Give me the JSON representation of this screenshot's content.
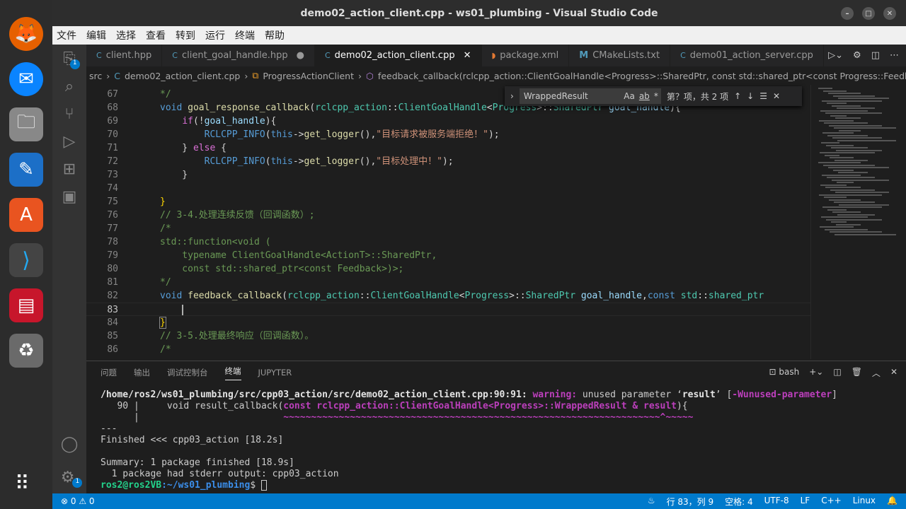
{
  "window": {
    "title": "demo02_action_client.cpp - ws01_plumbing - Visual Studio Code"
  },
  "menu": [
    "文件",
    "编辑",
    "选择",
    "查看",
    "转到",
    "运行",
    "终端",
    "帮助"
  ],
  "tabs": [
    {
      "label": "client.hpp"
    },
    {
      "label": "client_goal_handle.hpp"
    },
    {
      "label": "demo02_action_client.cpp"
    },
    {
      "label": "package.xml"
    },
    {
      "label": "CMakeLists.txt"
    },
    {
      "label": "demo01_action_server.cpp"
    }
  ],
  "breadcrumb": [
    "src",
    "demo02_action_client.cpp",
    "ProgressActionClient",
    "feedback_callback(rclcpp_action::ClientGoalHandle<Progress>::SharedPtr, const std::shared_ptr<const Progress::Feedback>)"
  ],
  "find": {
    "value": "WrappedResult",
    "options": [
      "Aa",
      "ab",
      "*"
    ],
    "result": "第？项，共 2 项"
  },
  "code": {
    "numbers": [
      "67",
      "68",
      "69",
      "70",
      "71",
      "72",
      "73",
      "74",
      "75",
      "76",
      "77",
      "78",
      "79",
      "80",
      "81",
      "82",
      "83",
      "84",
      "85",
      "86"
    ]
  },
  "panel": {
    "tabs": [
      "问题",
      "输出",
      "调试控制台",
      "终端",
      "JUPYTER"
    ],
    "shell": "bash"
  },
  "terminal": {
    "path": "/home/ros2/ws01_plumbing/src/cpp03_action/src/demo02_action_client.cpp:90:91:",
    "warning": "warning:",
    "msg1": " unused parameter ‘",
    "param": "result",
    "msg2": "’ [",
    "flag": "-Wunused-parameter",
    "msg3": "]",
    "l2a": "   90 |     void result_callback(",
    "l2b": "const rclcpp_action::ClientGoalHandle<Progress>::WrappedResult & result",
    "l2c": "){",
    "l3a": "      |                          ",
    "l3b": "~~~~~~~~~~~~~~~~~~~~~~~~~~~~~~~~~~~~~~~~~~~~~~~~~~~~~~~~~~~~~~~~~~~~^~~~~~",
    "l4": "---",
    "l5": "Finished <<< cpp03_action [18.2s]",
    "l6": "Summary: 1 package finished [18.9s]",
    "l7": "  1 package had stderr output: cpp03_action",
    "prompt_user": "ros2@ros2VB",
    "prompt_path": ":~/ws01_plumbing",
    "prompt_end": "$ "
  },
  "status": {
    "errors": "0",
    "warnings": "0",
    "position": "行 83，列 9",
    "indent": "空格: 4",
    "encoding": "UTF-8",
    "eol": "LF",
    "language": "C++",
    "platform": "Linux"
  },
  "badges": {
    "explorer": "1",
    "manage": "1"
  }
}
